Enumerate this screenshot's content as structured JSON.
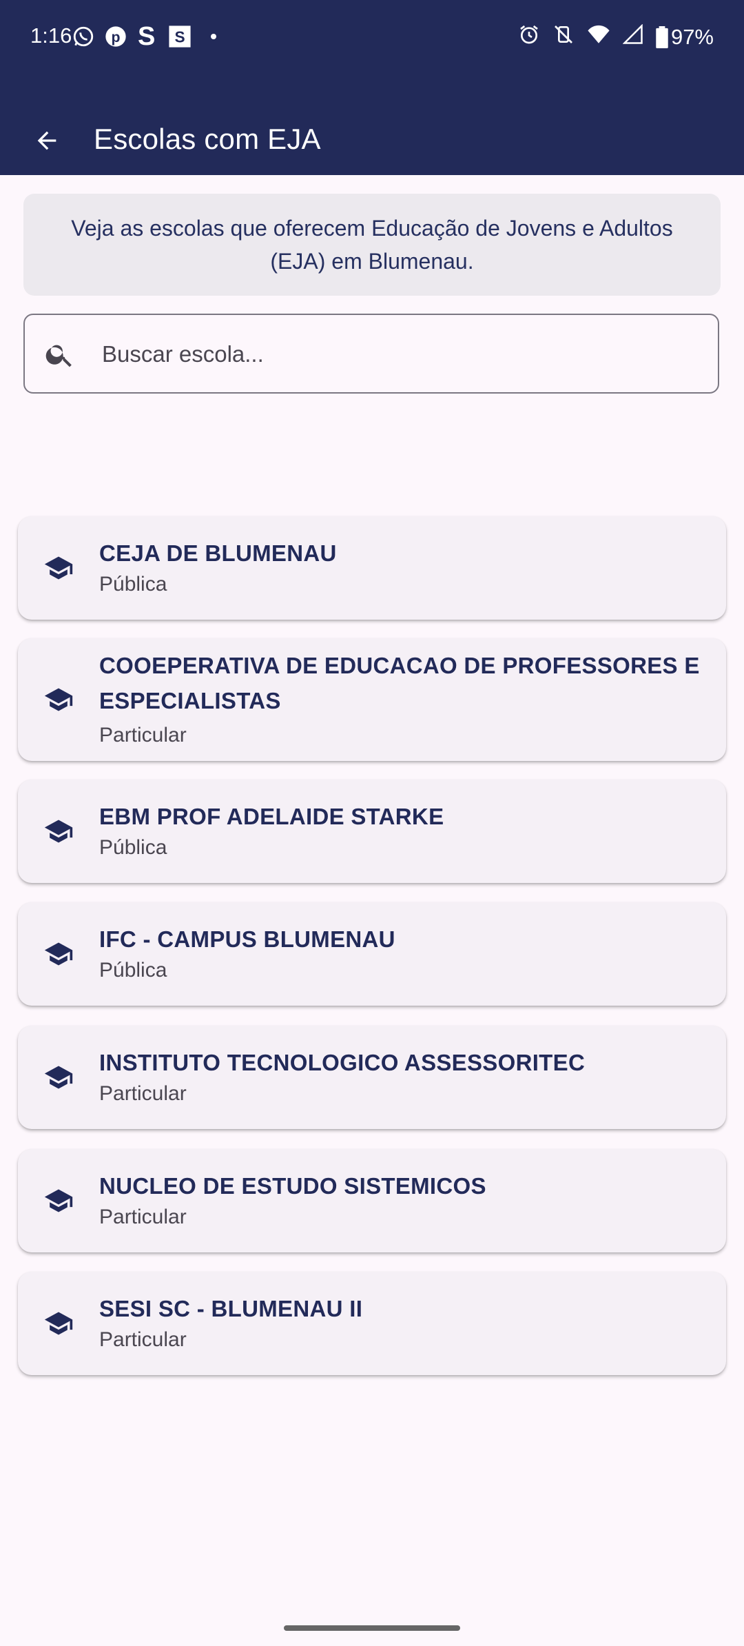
{
  "status_bar": {
    "time": "1:16",
    "battery": "97%",
    "left_icons": [
      "whatsapp-icon",
      "pinterest-icon",
      "s-icon",
      "s-box-icon",
      "dot-icon"
    ],
    "right_icons": [
      "alarm-icon",
      "vibrate-off-icon",
      "wifi-icon",
      "signal-icon",
      "battery-icon"
    ]
  },
  "app_bar": {
    "title": "Escolas com EJA",
    "back_icon": "arrow-left-icon",
    "color": "#222a59"
  },
  "info": {
    "text": "Veja as escolas que oferecem Educação de Jovens e Adultos (EJA) em Blumenau."
  },
  "search": {
    "placeholder": "Buscar escola...",
    "value": "",
    "icon": "search-icon"
  },
  "schools": [
    {
      "name": "CEJA DE BLUMENAU",
      "type": "Pública",
      "icon": "graduation-cap-icon"
    },
    {
      "name": "COOEPERATIVA DE EDUCACAO DE PROFESSORES E ESPECIALISTAS",
      "type": "Particular",
      "icon": "graduation-cap-icon"
    },
    {
      "name": "EBM PROF ADELAIDE STARKE",
      "type": "Pública",
      "icon": "graduation-cap-icon"
    },
    {
      "name": "IFC - CAMPUS BLUMENAU",
      "type": "Pública",
      "icon": "graduation-cap-icon"
    },
    {
      "name": "INSTITUTO TECNOLOGICO ASSESSORITEC",
      "type": "Particular",
      "icon": "graduation-cap-icon"
    },
    {
      "name": "NUCLEO DE ESTUDO SISTEMICOS",
      "type": "Particular",
      "icon": "graduation-cap-icon"
    },
    {
      "name": "SESI SC - BLUMENAU II",
      "type": "Particular",
      "icon": "graduation-cap-icon"
    }
  ]
}
